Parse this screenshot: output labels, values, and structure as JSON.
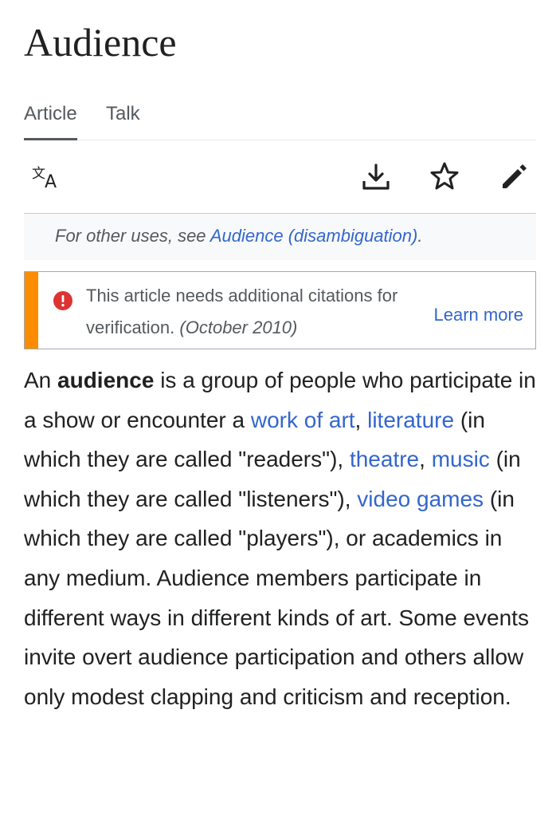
{
  "page": {
    "title": "Audience"
  },
  "tabs": [
    {
      "label": "Article",
      "active": true
    },
    {
      "label": "Talk",
      "active": false
    }
  ],
  "toolbar": {
    "icons": [
      "language-icon",
      "download-icon",
      "star-icon",
      "edit-icon"
    ]
  },
  "hatnote": {
    "prefix": "For other uses, see ",
    "link": "Audience (disambiguation)",
    "suffix": "."
  },
  "notice": {
    "text": "This article needs additional citations for verification.",
    "date": "(October 2010)",
    "learn_more": "Learn more",
    "accent": "#fc8d02",
    "icon_color": "#dd3333"
  },
  "article": {
    "p1_a": "An ",
    "p1_bold": "audience",
    "p1_b": " is a group of people who participate in a show or encounter a ",
    "link_work_of_art": "work of art",
    "p1_c": ", ",
    "link_literature": "literature",
    "p1_d": " (in which they are called \"readers\"), ",
    "link_theatre": "theatre",
    "p1_e": ", ",
    "link_music": "music",
    "p1_f": " (in which they are called \"listeners\"), ",
    "link_video_games": "video games",
    "p1_g": " (in which they are called \"players\"), or academics in any medium. Audience members participate in different ways in different kinds of art. Some events invite overt audience participation and others allow only modest clapping and criticism and reception."
  },
  "colors": {
    "link": "#3366cc",
    "text": "#202122",
    "muted": "#54595d"
  }
}
